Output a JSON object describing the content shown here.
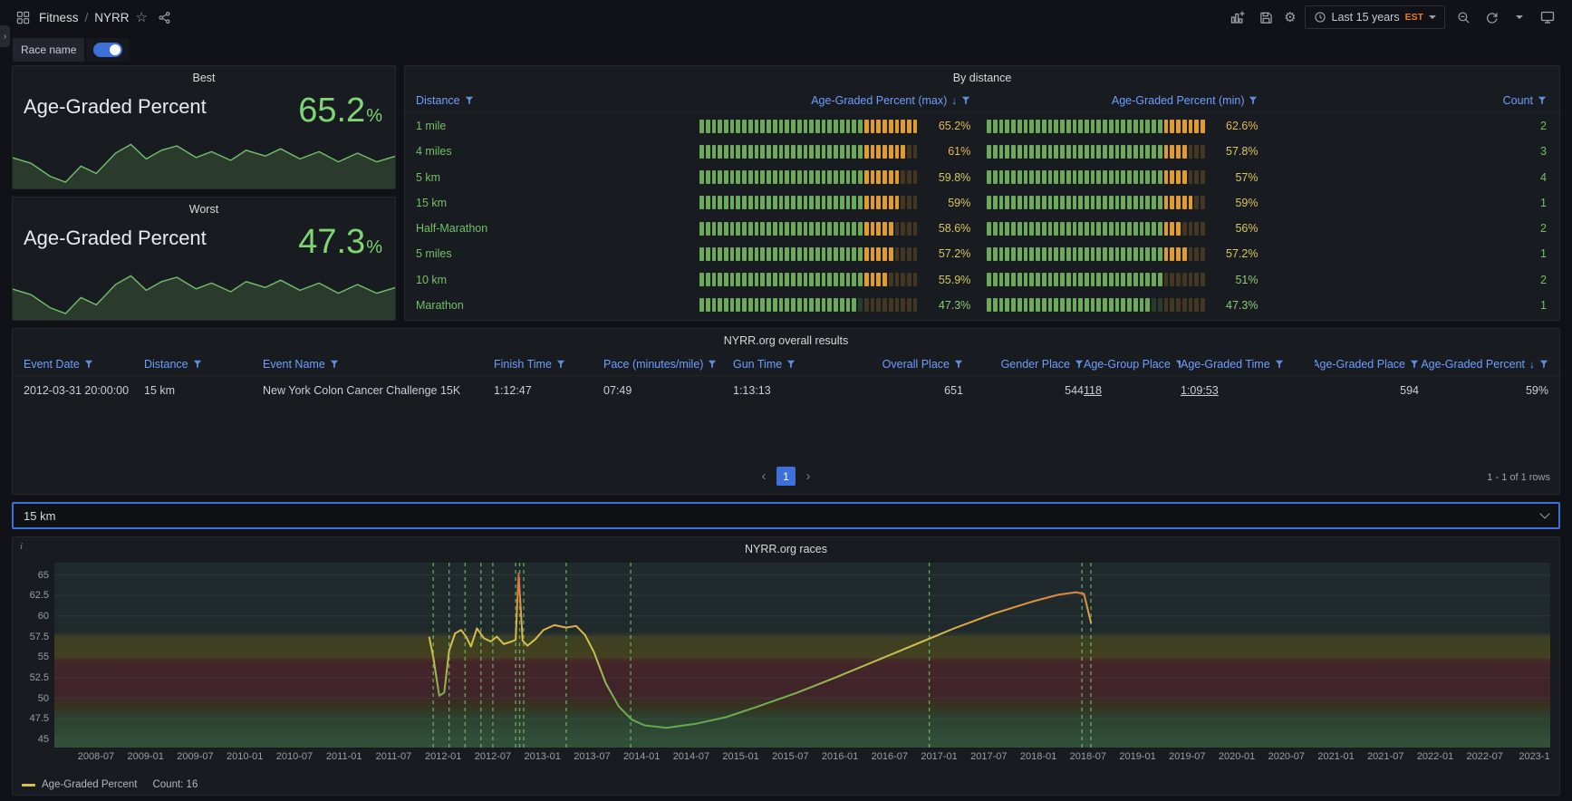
{
  "icons": {
    "star": "☆",
    "gear": "⚙",
    "expand": "›",
    "info": "i",
    "sort_desc": "↓"
  },
  "topbar": {
    "breadcrumb": {
      "app": "Fitness",
      "separator": "/",
      "page": "NYRR"
    },
    "time_picker": {
      "label": "Last 15 years",
      "timezone": "EST"
    }
  },
  "variables": {
    "race_name_label": "Race name",
    "distance_select_value": "15 km"
  },
  "best_panel": {
    "title": "Best",
    "metric_label": "Age-Graded Percent",
    "value": "65.2",
    "unit": "%",
    "sparkline": [
      [
        0,
        18
      ],
      [
        5,
        22
      ],
      [
        10,
        31
      ],
      [
        14,
        35
      ],
      [
        18,
        24
      ],
      [
        22,
        29
      ],
      [
        27,
        15
      ],
      [
        31,
        9
      ],
      [
        35,
        19
      ],
      [
        39,
        13
      ],
      [
        43,
        10
      ],
      [
        48,
        18
      ],
      [
        52,
        14
      ],
      [
        57,
        20
      ],
      [
        61,
        13
      ],
      [
        66,
        17
      ],
      [
        70,
        12
      ],
      [
        75,
        19
      ],
      [
        80,
        14
      ],
      [
        85,
        21
      ],
      [
        90,
        15
      ],
      [
        95,
        21
      ],
      [
        100,
        17
      ]
    ]
  },
  "worst_panel": {
    "title": "Worst",
    "metric_label": "Age-Graded Percent",
    "value": "47.3",
    "unit": "%",
    "sparkline": [
      [
        0,
        18
      ],
      [
        5,
        22
      ],
      [
        10,
        31
      ],
      [
        14,
        35
      ],
      [
        18,
        24
      ],
      [
        22,
        29
      ],
      [
        27,
        15
      ],
      [
        31,
        9
      ],
      [
        35,
        19
      ],
      [
        39,
        13
      ],
      [
        43,
        10
      ],
      [
        48,
        18
      ],
      [
        52,
        14
      ],
      [
        57,
        20
      ],
      [
        61,
        13
      ],
      [
        66,
        17
      ],
      [
        70,
        12
      ],
      [
        75,
        19
      ],
      [
        80,
        14
      ],
      [
        85,
        21
      ],
      [
        90,
        15
      ],
      [
        95,
        21
      ],
      [
        100,
        17
      ]
    ]
  },
  "by_distance": {
    "title": "By distance",
    "columns": [
      {
        "label": "Distance"
      },
      {
        "label": "Age-Graded Percent (max)",
        "sorted": "desc"
      },
      {
        "label": "Age-Graded Percent (min)"
      },
      {
        "label": "Count"
      }
    ],
    "gauge": {
      "max_scale": 65.2,
      "min_scale": 62.6,
      "orange_from_max": 0.74,
      "orange_from_min": 0.8,
      "segments": 36
    },
    "rows": [
      {
        "distance": "1 mile",
        "max": 65.2,
        "max_text": "65.2%",
        "min": 62.6,
        "min_text": "62.6%",
        "count": "2"
      },
      {
        "distance": "4 miles",
        "max": 61,
        "max_text": "61%",
        "min": 57.8,
        "min_text": "57.8%",
        "count": "3"
      },
      {
        "distance": "5 km",
        "max": 59.8,
        "max_text": "59.8%",
        "min": 57,
        "min_text": "57%",
        "count": "4"
      },
      {
        "distance": "15 km",
        "max": 59,
        "max_text": "59%",
        "min": 59,
        "min_text": "59%",
        "count": "1"
      },
      {
        "distance": "Half-Marathon",
        "max": 58.6,
        "max_text": "58.6%",
        "min": 56,
        "min_text": "56%",
        "count": "2"
      },
      {
        "distance": "5 miles",
        "max": 57.2,
        "max_text": "57.2%",
        "min": 57.2,
        "min_text": "57.2%",
        "count": "1"
      },
      {
        "distance": "10 km",
        "max": 55.9,
        "max_text": "55.9%",
        "min": 51,
        "min_text": "51%",
        "count": "2"
      },
      {
        "distance": "Marathon",
        "max": 47.3,
        "max_text": "47.3%",
        "min": 47.3,
        "min_text": "47.3%",
        "count": "1"
      }
    ]
  },
  "results": {
    "title": "NYRR.org overall results",
    "columns": [
      "Event Date",
      "Distance",
      "Event Name",
      "Finish Time",
      "Pace (minutes/mile)",
      "Gun Time",
      "Overall Place",
      "Gender Place",
      "Age-Group Place",
      "Age-Graded Time",
      "Age-Graded Place",
      "Age-Graded Percent"
    ],
    "cells": [
      "2012-03-31 20:00:00",
      "15 km",
      "New York Colon Cancer Challenge 15K",
      "1:12:47",
      "07:49",
      "1:13:13",
      "651",
      "544",
      "118",
      "1:09:53",
      "594",
      "59%"
    ],
    "pagination": {
      "prev": "‹",
      "page": "1",
      "next": "›",
      "range_text": "1 - 1 of 1 rows"
    }
  },
  "chart_data": {
    "type": "line",
    "title": "NYRR.org races",
    "ylim": [
      44,
      66.5
    ],
    "xlim": [
      2008.08,
      2023.16
    ],
    "y_ticks": [
      65,
      62.5,
      60,
      57.5,
      55,
      52.5,
      50,
      47.5,
      45
    ],
    "x_ticks": [
      "2008-07",
      "2009-01",
      "2009-07",
      "2010-01",
      "2010-07",
      "2011-01",
      "2011-07",
      "2012-01",
      "2012-07",
      "2013-01",
      "2013-07",
      "2014-01",
      "2014-07",
      "2015-01",
      "2015-07",
      "2016-01",
      "2016-07",
      "2017-01",
      "2017-07",
      "2018-01",
      "2018-07",
      "2019-01",
      "2019-07",
      "2020-01",
      "2020-07",
      "2021-01",
      "2021-07",
      "2022-01",
      "2022-07",
      "2023-1"
    ],
    "series": [
      {
        "name": "Age-Graded Percent",
        "points": [
          [
            2011.86,
            57.4
          ],
          [
            2011.9,
            55
          ],
          [
            2011.96,
            50.3
          ],
          [
            2012.01,
            50.7
          ],
          [
            2012.06,
            55.8
          ],
          [
            2012.12,
            57.9
          ],
          [
            2012.18,
            58.3
          ],
          [
            2012.23,
            57.5
          ],
          [
            2012.28,
            56.3
          ],
          [
            2012.34,
            58.5
          ],
          [
            2012.41,
            57.3
          ],
          [
            2012.48,
            56.9
          ],
          [
            2012.54,
            57.5
          ],
          [
            2012.61,
            56.6
          ],
          [
            2012.69,
            56.9
          ],
          [
            2012.73,
            57.1
          ],
          [
            2012.76,
            65.2
          ],
          [
            2012.8,
            57
          ],
          [
            2012.85,
            56.4
          ],
          [
            2012.93,
            57.2
          ],
          [
            2013.01,
            58.3
          ],
          [
            2013.12,
            58.9
          ],
          [
            2013.24,
            58.6
          ],
          [
            2013.34,
            58.8
          ],
          [
            2013.43,
            57.7
          ],
          [
            2013.52,
            55.6
          ],
          [
            2013.64,
            51.8
          ],
          [
            2013.77,
            49
          ],
          [
            2013.9,
            47.4
          ],
          [
            2014.03,
            46.7
          ],
          [
            2014.25,
            46.4
          ],
          [
            2014.55,
            46.9
          ],
          [
            2014.85,
            47.7
          ],
          [
            2015.15,
            48.9
          ],
          [
            2015.55,
            50.6
          ],
          [
            2015.95,
            52.5
          ],
          [
            2016.35,
            54.5
          ],
          [
            2016.75,
            56.5
          ],
          [
            2017.15,
            58.5
          ],
          [
            2017.55,
            60.3
          ],
          [
            2017.95,
            61.8
          ],
          [
            2018.2,
            62.6
          ],
          [
            2018.38,
            62.9
          ],
          [
            2018.46,
            62.7
          ],
          [
            2018.53,
            59.2
          ]
        ]
      }
    ],
    "annotations": [
      2011.9,
      2012.06,
      2012.22,
      2012.38,
      2012.5,
      2012.73,
      2012.77,
      2012.81,
      2013.24,
      2013.89,
      2016.9,
      2018.44,
      2018.53
    ],
    "legend": {
      "series_label": "Age-Graded Percent",
      "count_label": "Count: 16"
    }
  }
}
